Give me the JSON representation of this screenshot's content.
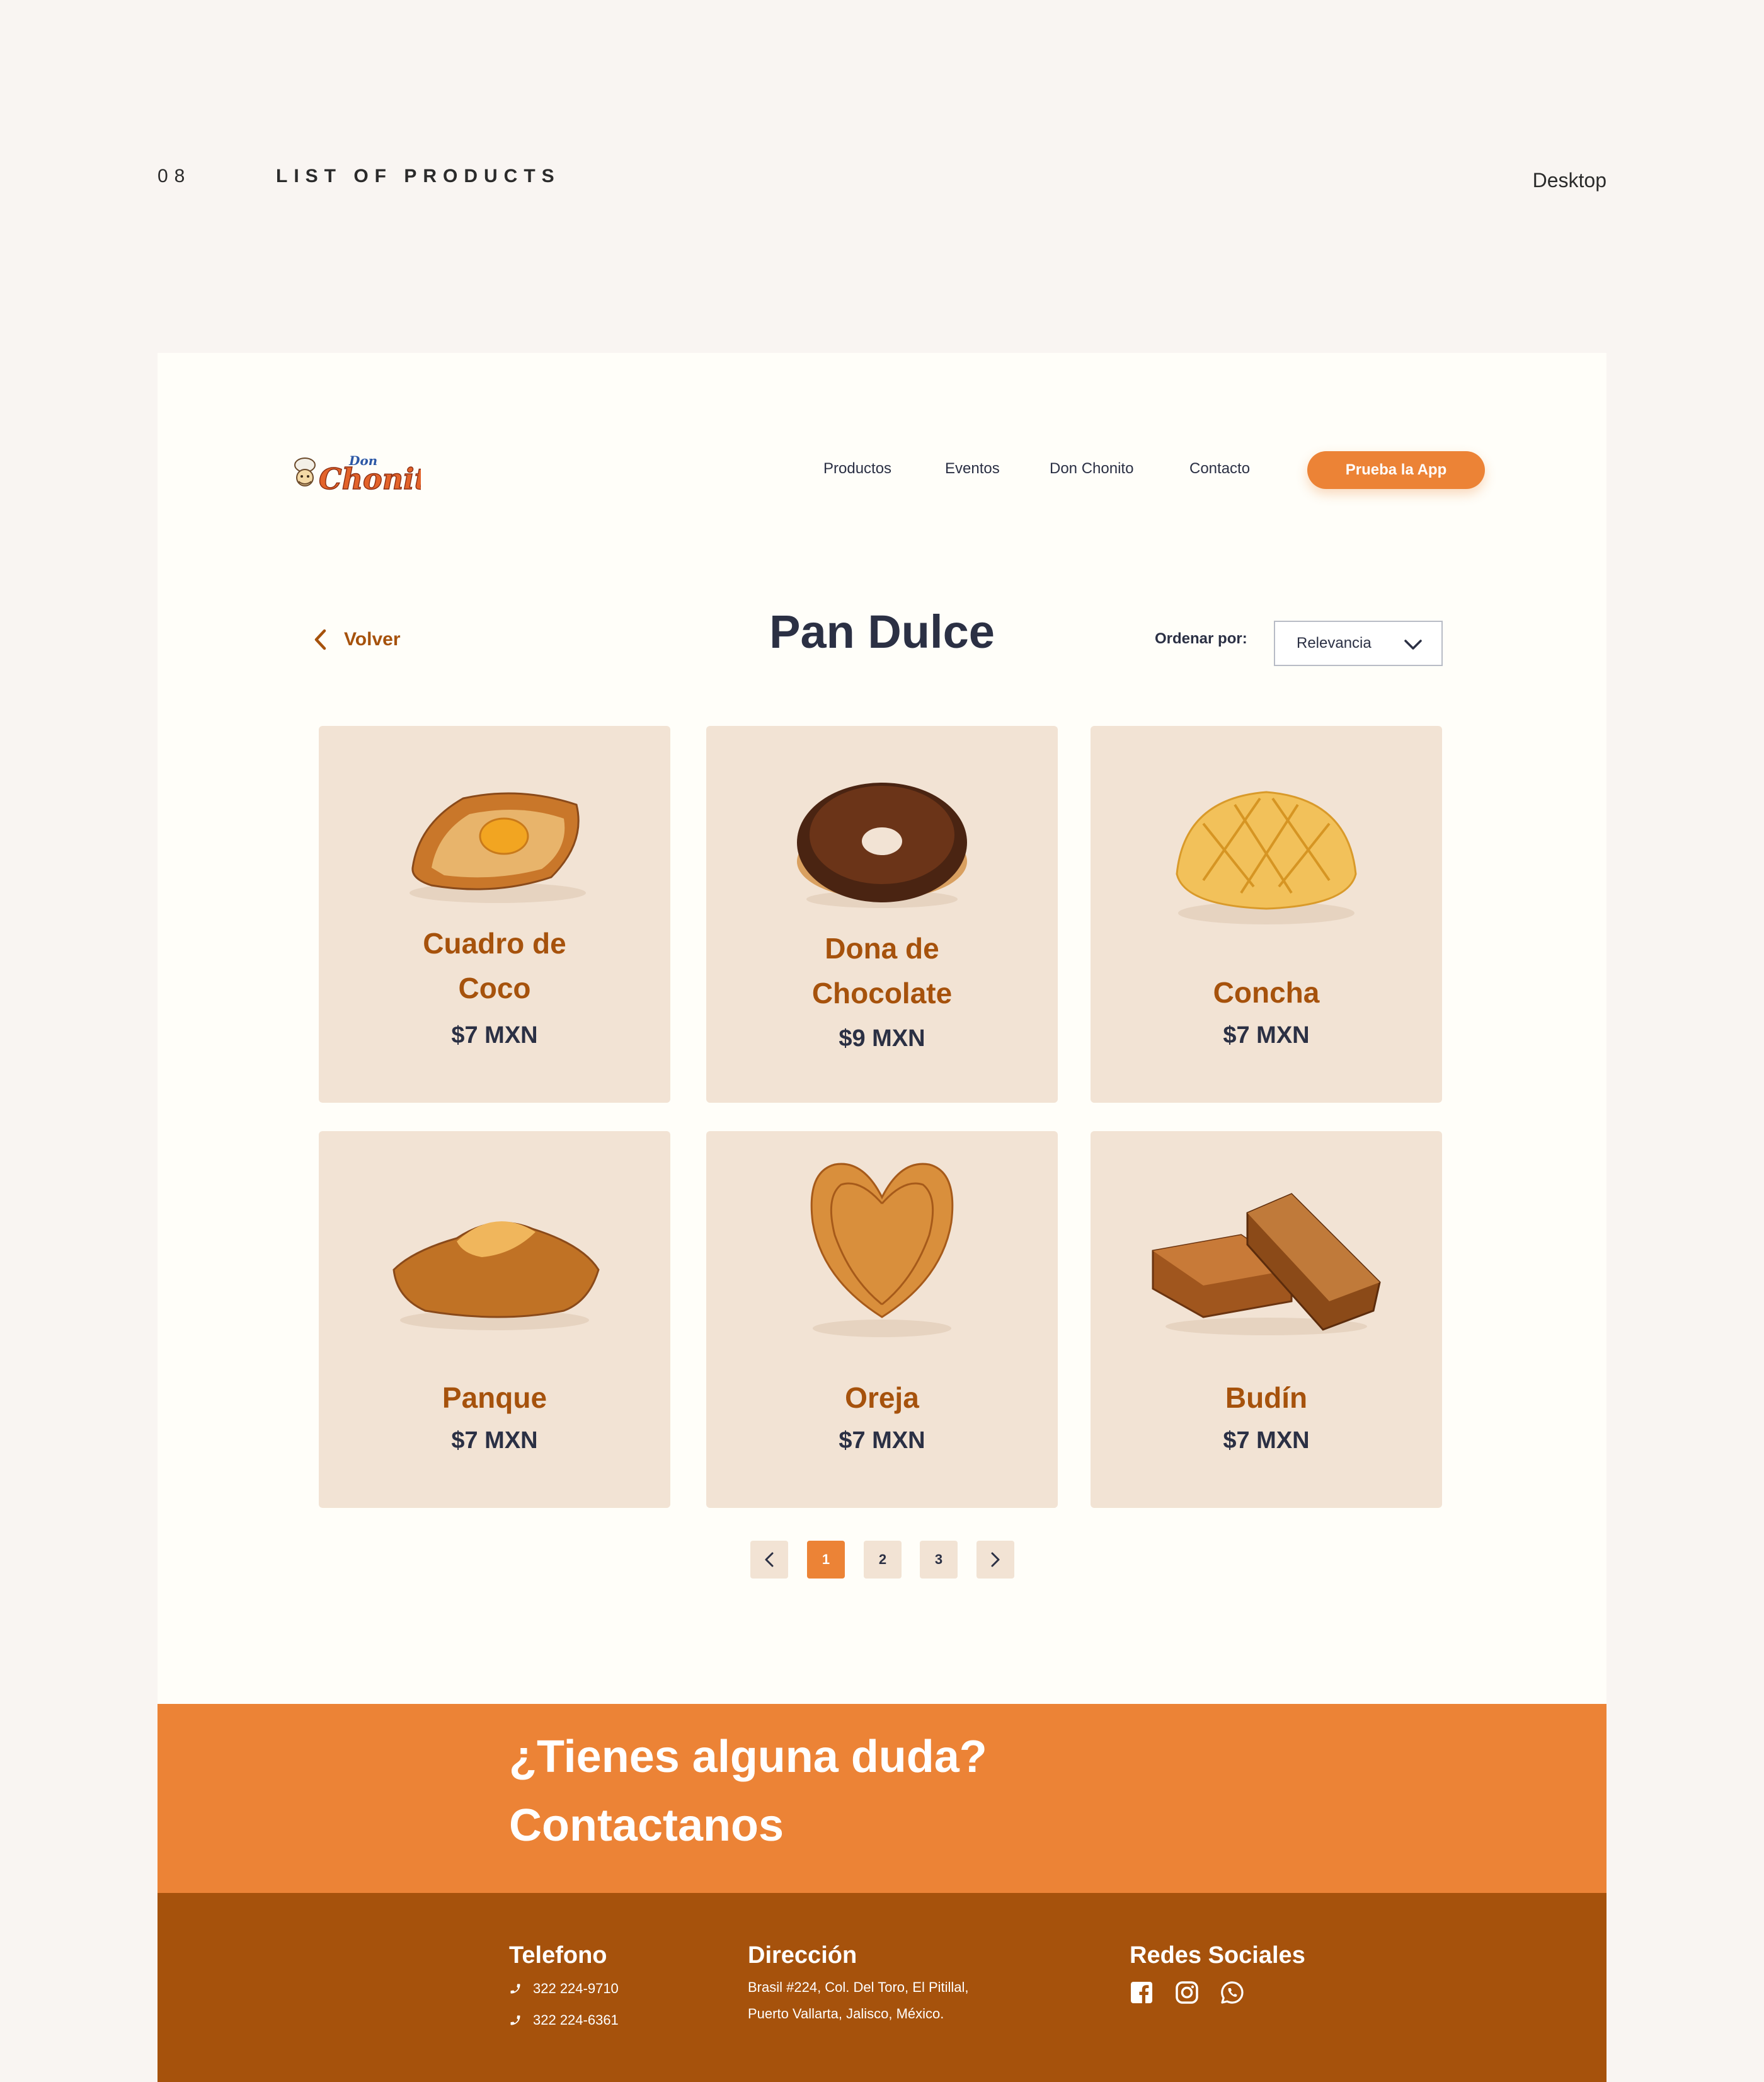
{
  "header": {
    "number": "08",
    "label": "LIST OF PRODUCTS",
    "device": "Desktop"
  },
  "nav": {
    "logo_alt": "Don Chonito",
    "links": [
      "Productos",
      "Eventos",
      "Don Chonito",
      "Contacto"
    ],
    "cta": "Prueba la App"
  },
  "toolbar": {
    "back_label": "Volver",
    "title": "Pan Dulce",
    "sort_label": "Ordenar por:",
    "sort_value": "Relevancia"
  },
  "products": [
    {
      "name_lines": [
        "Cuadro de",
        "Coco"
      ],
      "price": "$7 MXN",
      "icon": "coconut-bread-image"
    },
    {
      "name_lines": [
        "Dona de",
        "Chocolate"
      ],
      "price": "$9 MXN",
      "icon": "chocolate-donut-image"
    },
    {
      "name_lines": [
        "Concha"
      ],
      "price": "$7 MXN",
      "icon": "concha-image"
    },
    {
      "name_lines": [
        "Panque"
      ],
      "price": "$7 MXN",
      "icon": "pound-cake-image"
    },
    {
      "name_lines": [
        "Oreja"
      ],
      "price": "$7 MXN",
      "icon": "oreja-image"
    },
    {
      "name_lines": [
        "Budín"
      ],
      "price": "$7 MXN",
      "icon": "bread-pudding-image"
    }
  ],
  "pagination": {
    "pages": [
      "1",
      "2",
      "3"
    ],
    "current": "1"
  },
  "contact": {
    "line1": "¿Tienes alguna duda?",
    "line2": "Contactanos"
  },
  "footer": {
    "phone_title": "Telefono",
    "phones": [
      "322 224-9710",
      "322 224-6361"
    ],
    "address_title": "Dirección",
    "address_lines": [
      "Brasil #224, Col. Del Toro, El Pitillal,",
      "Puerto Vallarta, Jalisco, México."
    ],
    "social_title": "Redes Sociales",
    "social_icons": [
      "facebook-icon",
      "instagram-icon",
      "whatsapp-icon"
    ]
  },
  "colors": {
    "accent": "#ec8336",
    "brown": "#a6520c",
    "card": "#f2e3d4",
    "text": "#2b3044"
  }
}
